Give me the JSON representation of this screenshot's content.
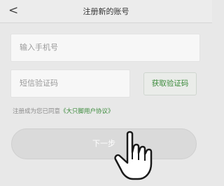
{
  "header": {
    "back_glyph": "<",
    "title": "注册新的账号"
  },
  "form": {
    "phone_placeholder": "输入手机号",
    "code_placeholder": "短信验证码",
    "get_code_label": "获取验证码"
  },
  "agreement": {
    "prefix": "注册成为您已同意",
    "link_text": "《大只脚用户协议》"
  },
  "next_label": "下一步",
  "icons": {
    "back": "chevron-left-icon",
    "pointer": "hand-pointer-icon"
  },
  "colors": {
    "accent": "#3b8a3b",
    "background": "#e8e8e8",
    "button_bg": "#dadada"
  }
}
